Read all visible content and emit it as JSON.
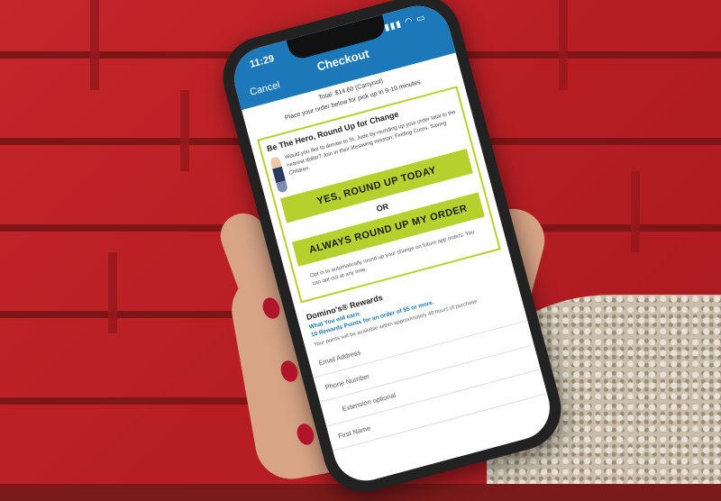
{
  "status_bar": {
    "time": "11:29",
    "signal": "▮▮▮ ◠ ▭"
  },
  "nav": {
    "title": "Checkout",
    "cancel": "Cancel"
  },
  "summary": {
    "total": "Total: $14.60 (Carryout)",
    "note": "Place your order below for pick up in 9-19 minutes."
  },
  "promo": {
    "heading": "Be The Hero, Round Up for Change",
    "body": "Would you like to donate to St. Jude by rounding up your order total to the nearest dollar? Join in their lifesaving mission: Finding Cures. Saving Children.",
    "round_up_today": "YES, ROUND UP TODAY",
    "or": "OR",
    "always_round_up": "ALWAYS ROUND UP MY ORDER",
    "opt_in": "Opt in to automatically round up your change on future app orders. You can opt out at any time."
  },
  "rewards": {
    "heading": "Domino's® Rewards",
    "what_you_earn": "What You will earn:",
    "points": "10 Rewards Points for an order of $5 or more.",
    "availability": "Your points will be available within approximately 48 hours of purchase."
  },
  "form": {
    "email": "Email Address",
    "phone": "Phone Number",
    "extension": "Extension optional",
    "first_name": "First Name"
  }
}
